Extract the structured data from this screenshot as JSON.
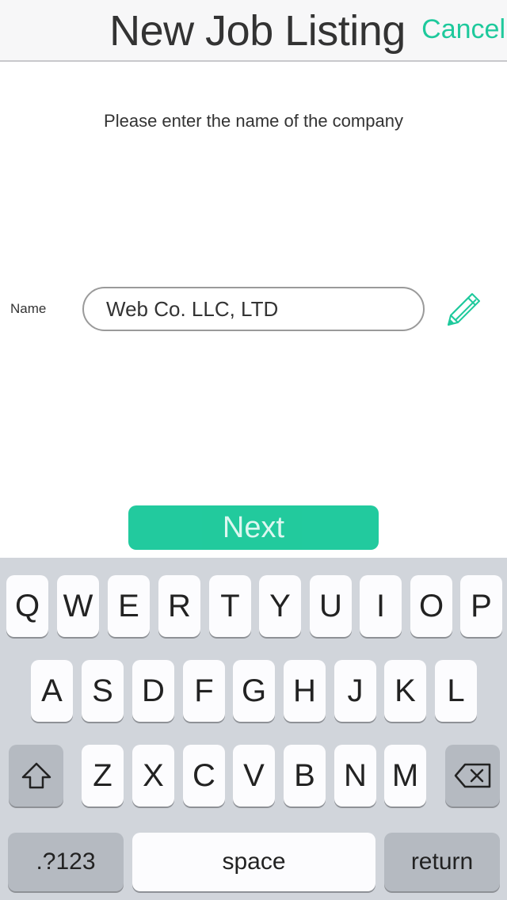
{
  "navbar": {
    "title": "New Job Listing",
    "cancel_label": "Cancel"
  },
  "prompt": "Please enter the name of the company",
  "form": {
    "name_label": "Name",
    "name_value": "Web Co. LLC, LTD"
  },
  "next_label": "Next",
  "keyboard": {
    "row1": [
      "Q",
      "W",
      "E",
      "R",
      "T",
      "Y",
      "U",
      "I",
      "O",
      "P"
    ],
    "row2": [
      "A",
      "S",
      "D",
      "F",
      "G",
      "H",
      "J",
      "K",
      "L"
    ],
    "row3": [
      "Z",
      "X",
      "C",
      "V",
      "B",
      "N",
      "M"
    ],
    "numbers_label": ".?123",
    "space_label": "space",
    "return_label": "return",
    "shift_icon": "shift-arrow-icon",
    "delete_icon": "backspace-icon"
  },
  "colors": {
    "accent": "#1ec99c"
  }
}
